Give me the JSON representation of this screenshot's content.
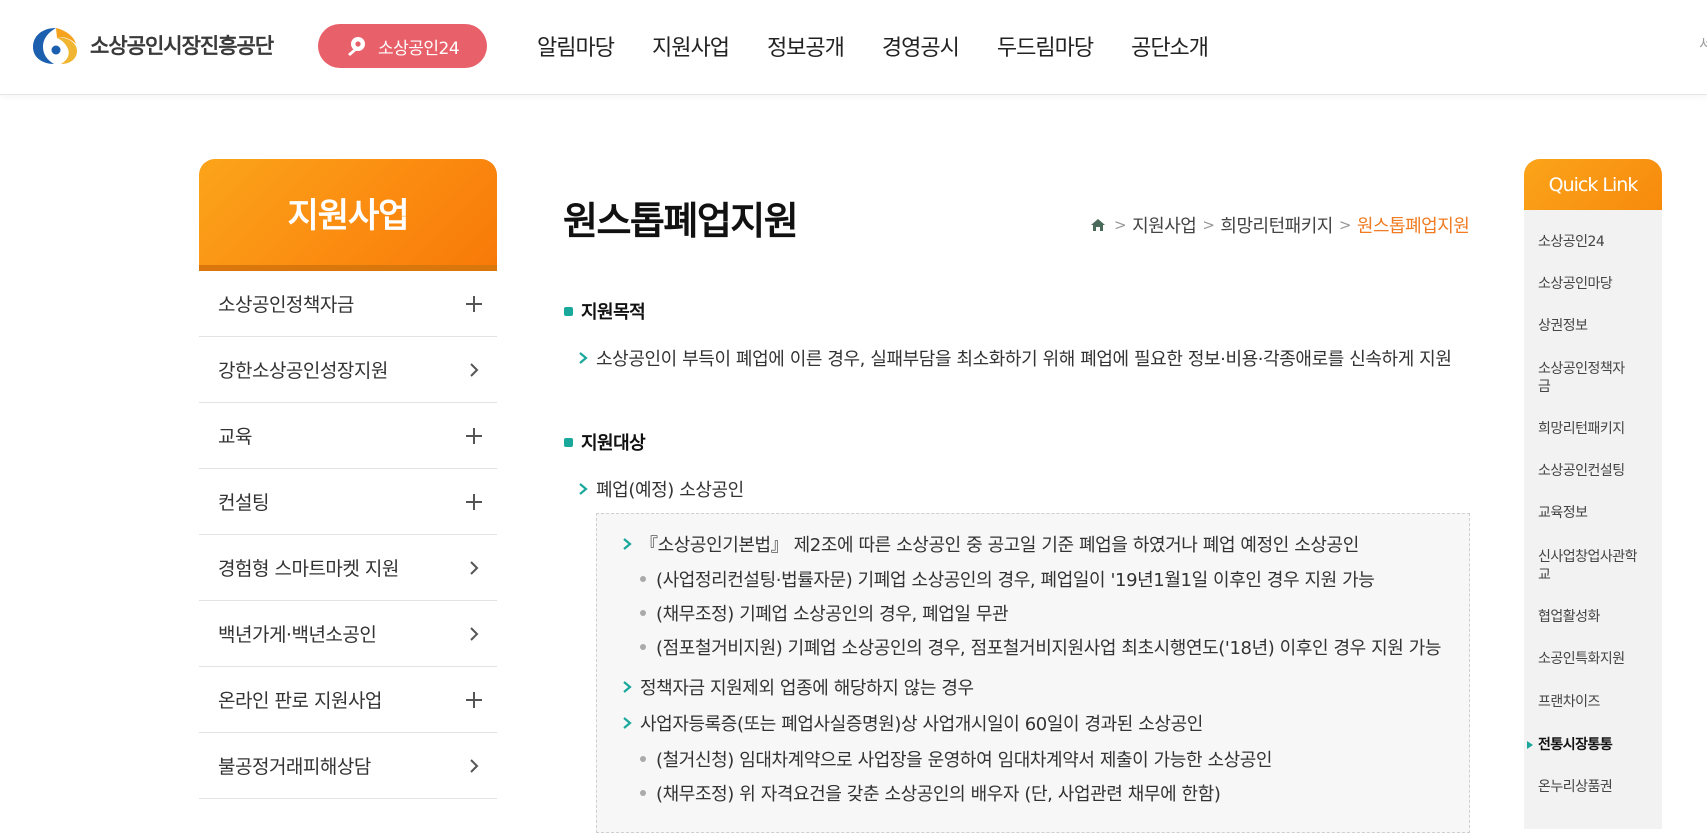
{
  "header": {
    "logo_text": "소상공인시장진흥공단",
    "pill_label": "소상공인24",
    "gnb": [
      "알림마당",
      "지원사업",
      "정보공개",
      "경영공시",
      "두드림마당",
      "공단소개"
    ],
    "edge_char": "서"
  },
  "lnb": {
    "title": "지원사업",
    "items": [
      {
        "label": "소상공인정책자금",
        "symbol": "plus"
      },
      {
        "label": "강한소상공인성장지원",
        "symbol": "chevron"
      },
      {
        "label": "교육",
        "symbol": "plus"
      },
      {
        "label": "컨설팅",
        "symbol": "plus"
      },
      {
        "label": "경험형 스마트마켓 지원",
        "symbol": "chevron"
      },
      {
        "label": "백년가게·백년소공인",
        "symbol": "chevron"
      },
      {
        "label": "온라인 판로 지원사업",
        "symbol": "plus"
      },
      {
        "label": "불공정거래피해상담",
        "symbol": "chevron"
      }
    ]
  },
  "main": {
    "title": "원스톱폐업지원",
    "breadcrumb": [
      "지원사업",
      "희망리턴패키지",
      "원스톱폐업지원"
    ],
    "purpose_title": "지원목적",
    "purpose_text": "소상공인이 부득이 폐업에 이른 경우, 실패부담을 최소화하기 위해 폐업에 필요한 정보·비용·각종애로를 신속하게 지원",
    "target_title": "지원대상",
    "target_text": "폐업(예정) 소상공인",
    "box": {
      "l1_a": "『소상공인기본법』 제2조에 따른 소상공인 중 공고일 기준 폐업을 하였거나 폐업 예정인 소상공인",
      "l2_a": "(사업정리컨설팅·법률자문) 기폐업 소상공인의 경우, 폐업일이 '19년1월1일 이후인 경우 지원 가능",
      "l2_b": "(채무조정) 기폐업 소상공인의 경우, 폐업일 무관",
      "l2_c": "(점포철거비지원) 기폐업 소상공인의 경우, 점포철거비지원사업 최초시행연도('18년) 이후인 경우 지원 가능",
      "l1_b": "정책자금 지원제외 업종에 해당하지 않는 경우",
      "l1_c": "사업자등록증(또는 폐업사실증명원)상 사업개시일이 60일이 경과된 소상공인",
      "l2_d": "(철거신청) 임대차계약으로 사업장을 운영하여 임대차계약서 제출이 가능한 소상공인",
      "l2_e": "(채무조정) 위 자격요건을 갖춘 소상공인의 배우자 (단, 사업관련 채무에 한함)"
    }
  },
  "quicklink": {
    "title": "Quick Link",
    "items": [
      "소상공인24",
      "소상공인마당",
      "상권정보",
      "소상공인정책자금",
      "희망리턴패키지",
      "소상공인컨설팅",
      "교육정보",
      "신사업창업사관학교",
      "협업활성화",
      "소공인특화지원",
      "프랜차이즈",
      "전통시장통통",
      "온누리상품권"
    ]
  },
  "colors": {
    "orange": "#fb8a10",
    "pink": "#e8606a",
    "teal": "#1aa79c",
    "breadcrumb_active": "#f07b22"
  }
}
